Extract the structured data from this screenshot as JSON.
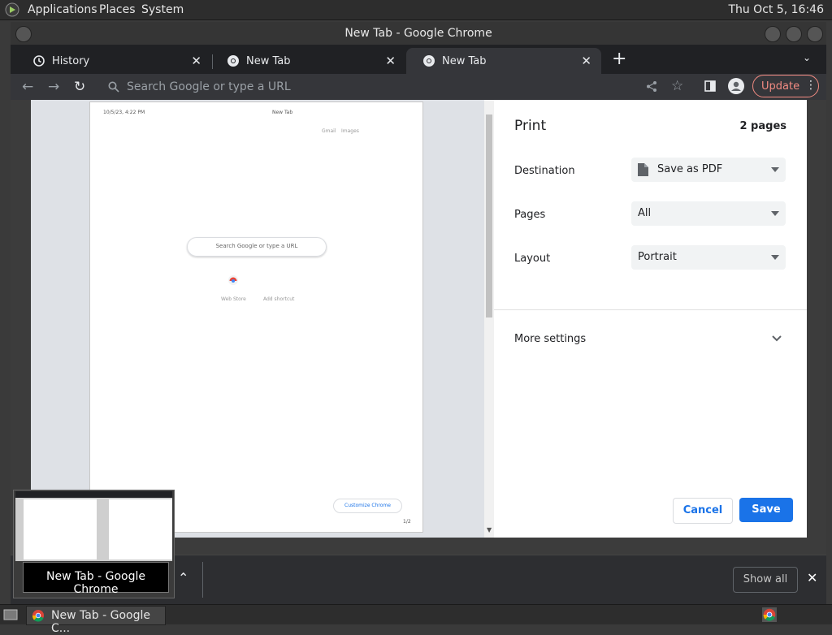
{
  "top_panel": {
    "menu": [
      "Applications",
      "Places",
      "System"
    ],
    "clock": "Thu Oct  5, 16:46"
  },
  "window": {
    "title": "New Tab - Google Chrome"
  },
  "tabs": [
    {
      "label": "History",
      "icon": "history-icon"
    },
    {
      "label": "New Tab",
      "icon": "chrome-icon"
    },
    {
      "label": "New Tab",
      "icon": "chrome-icon",
      "active": true
    }
  ],
  "toolbar": {
    "omnibox_placeholder": "Search Google or type a URL",
    "update_label": "Update"
  },
  "preview": {
    "header_date": "10/5/23, 4:22 PM",
    "header_title": "New Tab",
    "links": [
      "Gmail",
      "Images"
    ],
    "search_placeholder": "Search Google or type a URL",
    "shortcuts": [
      "Web Store",
      "Add shortcut"
    ],
    "customize_label": "Customize Chrome",
    "page_number": "1/2"
  },
  "print": {
    "title": "Print",
    "page_count": "2 pages",
    "destination_label": "Destination",
    "destination_value": "Save as PDF",
    "pages_label": "Pages",
    "pages_value": "All",
    "layout_label": "Layout",
    "layout_value": "Portrait",
    "more_settings_label": "More settings",
    "cancel_label": "Cancel",
    "save_label": "Save"
  },
  "download_bar": {
    "show_all_label": "Show all"
  },
  "taskbar": {
    "task_label": "New Tab - Google C..."
  },
  "thumbnail": {
    "tooltip": "New Tab - Google Chrome"
  },
  "colors": {
    "accent_blue": "#1a73e8",
    "update_red": "#f28b82",
    "dark_bg": "#202124"
  }
}
